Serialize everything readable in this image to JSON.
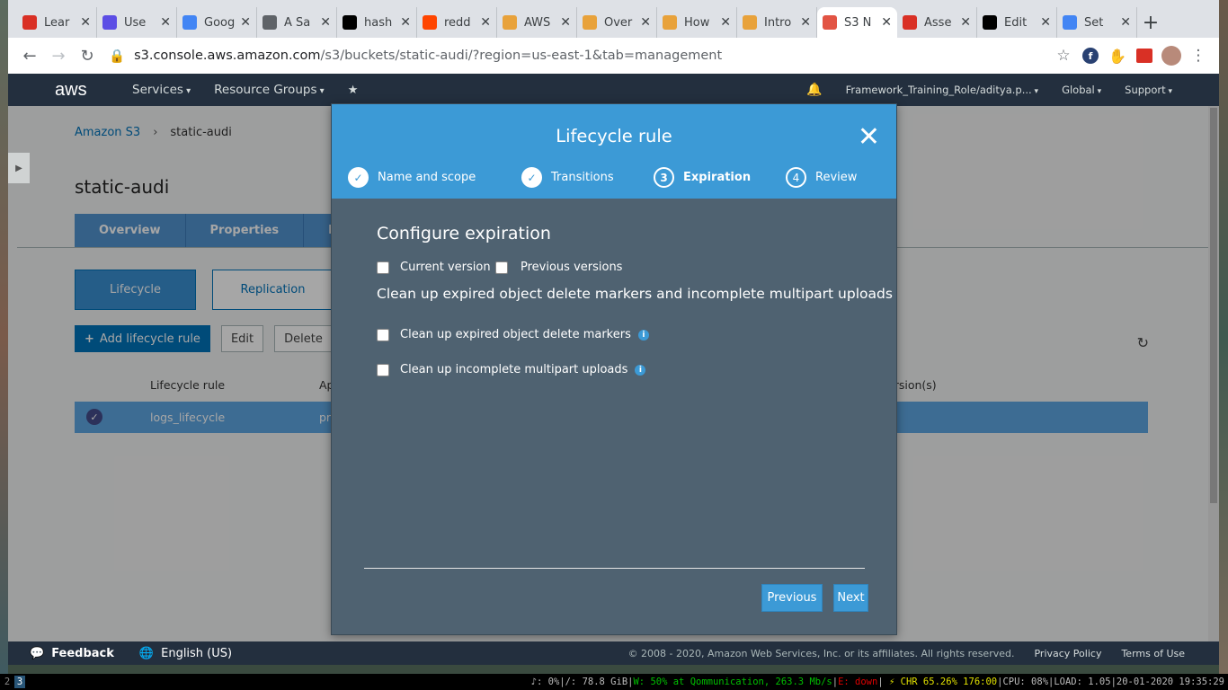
{
  "browser": {
    "tabs": [
      {
        "label": "Lear",
        "icon": "doc-icon",
        "color": "#d93025"
      },
      {
        "label": "Use",
        "icon": "terraform-icon",
        "color": "#5c4ee5"
      },
      {
        "label": "Goog",
        "icon": "gcloud-icon",
        "color": "#4285f4"
      },
      {
        "label": "A Sa",
        "icon": "globe-icon",
        "color": "#5f6368"
      },
      {
        "label": "hash",
        "icon": "github-icon",
        "color": "#000000"
      },
      {
        "label": "redd",
        "icon": "reddit-icon",
        "color": "#ff4500"
      },
      {
        "label": "AWS",
        "icon": "aws-box-icon",
        "color": "#e8a23b"
      },
      {
        "label": "Over",
        "icon": "aws-box-icon",
        "color": "#e8a23b"
      },
      {
        "label": "How",
        "icon": "aws-box-icon",
        "color": "#e8a23b"
      },
      {
        "label": "Intro",
        "icon": "aws-box-icon",
        "color": "#e8a23b"
      },
      {
        "label": "S3 N",
        "icon": "aws-s3-icon",
        "color": "#e25444",
        "active": true
      },
      {
        "label": "Asse",
        "icon": "gmail-icon",
        "color": "#d93025"
      },
      {
        "label": "Edit",
        "icon": "github-icon",
        "color": "#000000"
      },
      {
        "label": "Set",
        "icon": "google-icon",
        "color": "#4285f4"
      }
    ],
    "url_host": "s3.console.aws.amazon.com",
    "url_path": "/s3/buckets/static-audi/?region=us-east-1&tab=management"
  },
  "aws_nav": {
    "logo": "aws",
    "services": "Services",
    "resource_groups": "Resource Groups",
    "account": "Framework_Training_Role/aditya.p...",
    "region": "Global",
    "support": "Support"
  },
  "page": {
    "breadcrumb_root": "Amazon S3",
    "breadcrumb_current": "static-audi",
    "title": "static-audi",
    "tabs": [
      "Overview",
      "Properties",
      "Perm"
    ],
    "subtabs": [
      "Lifecycle",
      "Replication"
    ],
    "actions": {
      "add": "Add lifecycle rule",
      "edit": "Edit",
      "delete": "Delete",
      "more": "A"
    },
    "table": {
      "headers": [
        "Lifecycle rule",
        "Ap",
        "ersion(s)"
      ],
      "rows": [
        {
          "name": "logs_lifecycle",
          "applied": "pr"
        }
      ]
    }
  },
  "modal": {
    "title": "Lifecycle rule",
    "steps": [
      {
        "num": "1",
        "label": "Name and scope",
        "state": "done"
      },
      {
        "num": "2",
        "label": "Transitions",
        "state": "done"
      },
      {
        "num": "3",
        "label": "Expiration",
        "state": "current"
      },
      {
        "num": "4",
        "label": "Review",
        "state": "pending"
      }
    ],
    "heading": "Configure expiration",
    "current_version": "Current version",
    "previous_versions": "Previous versions",
    "cleanup_heading": "Clean up expired object delete markers and incomplete multipart uploads",
    "cleanup_markers": "Clean up expired object delete markers",
    "cleanup_multipart": "Clean up incomplete multipart uploads",
    "previous_button": "Previous",
    "next_button": "Next"
  },
  "footer": {
    "feedback": "Feedback",
    "language": "English (US)",
    "copyright": "© 2008 - 2020, Amazon Web Services, Inc. or its affiliates. All rights reserved.",
    "privacy": "Privacy Policy",
    "terms": "Terms of Use"
  },
  "statusbar": {
    "workspaces": [
      "2",
      "3"
    ],
    "volume": "♪: 0%",
    "disk": "/: 78.8 GiB",
    "wifi": "W: 50% at Qommunication, 263.3 Mb/s",
    "eth": "E: down",
    "battery": "⚡ CHR 65.26% 176:00",
    "cpu": "CPU: 08%",
    "load": "LOAD: 1.05",
    "datetime": "20-01-2020 19:35:29"
  }
}
